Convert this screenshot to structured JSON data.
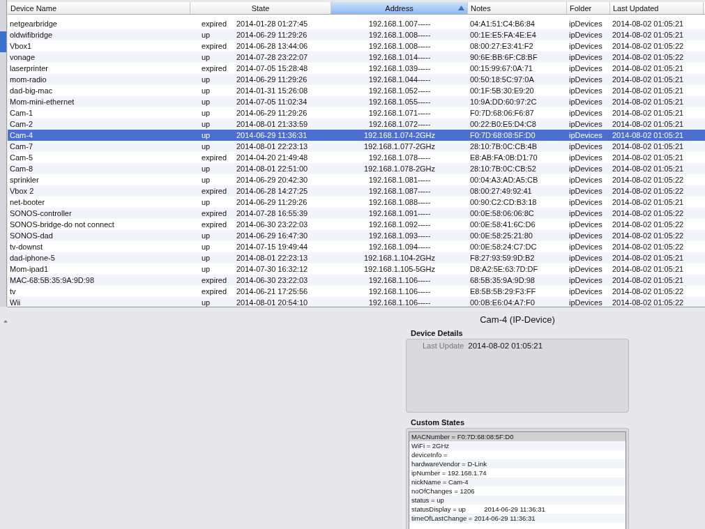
{
  "table": {
    "columns": [
      {
        "label": "Device Name",
        "sorted": false
      },
      {
        "label": "State",
        "sorted": false
      },
      {
        "label": "Address",
        "sorted": true
      },
      {
        "label": "Notes",
        "sorted": false
      },
      {
        "label": "Folder",
        "sorted": false
      },
      {
        "label": "Last Updated",
        "sorted": false
      }
    ],
    "rows": [
      {
        "name": "netgearbridge",
        "state": "expired",
        "changed": "2014-01-28 01:27:45",
        "address": "192.168.1.007-----",
        "notes": "04:A1:51:C4:B6:84",
        "folder": "ipDevices",
        "updated": "2014-08-02 01:05:21",
        "selected": false
      },
      {
        "name": "oldwifibridge",
        "state": "up",
        "changed": "2014-06-29 11:29:26",
        "address": "192.168.1.008-----",
        "notes": "00:1E:E5:FA:4E:E4",
        "folder": "ipDevices",
        "updated": "2014-08-02 01:05:21",
        "selected": false
      },
      {
        "name": "Vbox1",
        "state": "expired",
        "changed": "2014-06-28 13:44:06",
        "address": "192.168.1.008-----",
        "notes": "08:00:27:E3:41:F2",
        "folder": "ipDevices",
        "updated": "2014-08-02 01:05:22",
        "selected": false
      },
      {
        "name": "vonage",
        "state": "up",
        "changed": "2014-07-28 23:22:07",
        "address": "192.168.1.014-----",
        "notes": "90:6E:BB:6F:C8:BF",
        "folder": "ipDevices",
        "updated": "2014-08-02 01:05:22",
        "selected": false
      },
      {
        "name": "laserprinter",
        "state": "expired",
        "changed": "2014-07-05 15:28:48",
        "address": "192.168.1.039-----",
        "notes": "00:15:99:67:0A:71",
        "folder": "ipDevices",
        "updated": "2014-08-02 01:05:21",
        "selected": false
      },
      {
        "name": "mom-radio",
        "state": "up",
        "changed": "2014-06-29 11:29:26",
        "address": "192.168.1.044-----",
        "notes": "00:50:18:5C:97:0A",
        "folder": "ipDevices",
        "updated": "2014-08-02 01:05:21",
        "selected": false
      },
      {
        "name": "dad-big-mac",
        "state": "up",
        "changed": "2014-01-31 15:26:08",
        "address": "192.168.1.052-----",
        "notes": "00:1F:5B:30:E9:20",
        "folder": "ipDevices",
        "updated": "2014-08-02 01:05:21",
        "selected": false
      },
      {
        "name": "Mom-mini-ethernet",
        "state": "up",
        "changed": "2014-07-05 11:02:34",
        "address": "192.168.1.055-----",
        "notes": "10:9A:DD:60:97:2C",
        "folder": "ipDevices",
        "updated": "2014-08-02 01:05:21",
        "selected": false
      },
      {
        "name": "Cam-1",
        "state": "up",
        "changed": "2014-06-29 11:29:26",
        "address": "192.168.1.071-----",
        "notes": "F0:7D:68:06:F6:87",
        "folder": "ipDevices",
        "updated": "2014-08-02 01:05:21",
        "selected": false
      },
      {
        "name": "Cam-2",
        "state": "up",
        "changed": "2014-08-01 21:33:59",
        "address": "192.168.1.072-----",
        "notes": "00:22:B0:E5:D4:C8",
        "folder": "ipDevices",
        "updated": "2014-08-02 01:05:21",
        "selected": false
      },
      {
        "name": "Cam-4",
        "state": "up",
        "changed": "2014-06-29 11:36:31",
        "address": "192.168.1.074-2GHz",
        "notes": "F0:7D:68:08:5F:D0",
        "folder": "ipDevices",
        "updated": "2014-08-02 01:05:21",
        "selected": true
      },
      {
        "name": "Cam-7",
        "state": "up",
        "changed": "2014-08-01 22:23:13",
        "address": "192.168.1.077-2GHz",
        "notes": "28:10:7B:0C:CB:4B",
        "folder": "ipDevices",
        "updated": "2014-08-02 01:05:21",
        "selected": false
      },
      {
        "name": "Cam-5",
        "state": "expired",
        "changed": "2014-04-20 21:49:48",
        "address": "192.168.1.078-----",
        "notes": "E8:AB:FA:0B:D1:70",
        "folder": "ipDevices",
        "updated": "2014-08-02 01:05:21",
        "selected": false
      },
      {
        "name": "Cam-8",
        "state": "up",
        "changed": "2014-08-01 22:51:00",
        "address": "192.168.1.078-2GHz",
        "notes": "28:10:7B:0C:CB:52",
        "folder": "ipDevices",
        "updated": "2014-08-02 01:05:21",
        "selected": false
      },
      {
        "name": "sprinkler",
        "state": "up",
        "changed": "2014-06-29 20:42:30",
        "address": "192.168.1.081-----",
        "notes": "00:04:A3:AD:A5:CB",
        "folder": "ipDevices",
        "updated": "2014-08-02 01:05:22",
        "selected": false
      },
      {
        "name": "Vbox 2",
        "state": "expired",
        "changed": "2014-06-28 14:27:25",
        "address": "192.168.1.087-----",
        "notes": "08:00:27:49:92:41",
        "folder": "ipDevices",
        "updated": "2014-08-02 01:05:22",
        "selected": false
      },
      {
        "name": "net-booter",
        "state": "up",
        "changed": "2014-06-29 11:29:26",
        "address": "192.168.1.088-----",
        "notes": "00:90:C2:CD:B3:18",
        "folder": "ipDevices",
        "updated": "2014-08-02 01:05:21",
        "selected": false
      },
      {
        "name": "SONOS-controller",
        "state": "expired",
        "changed": "2014-07-28 16:55:39",
        "address": "192.168.1.091-----",
        "notes": "00:0E:58:06:06:8C",
        "folder": "ipDevices",
        "updated": "2014-08-02 01:05:22",
        "selected": false
      },
      {
        "name": "SONOS-bridge-do not connect",
        "state": "expired",
        "changed": "2014-06-30 23:22:03",
        "address": "192.168.1.092-----",
        "notes": "00:0E:58:41:6C:D6",
        "folder": "ipDevices",
        "updated": "2014-08-02 01:05:22",
        "selected": false
      },
      {
        "name": "SONOS-dad",
        "state": "up",
        "changed": "2014-06-29 16:47:30",
        "address": "192.168.1.093-----",
        "notes": "00:0E:58:25:21:80",
        "folder": "ipDevices",
        "updated": "2014-08-02 01:05:22",
        "selected": false
      },
      {
        "name": "tv-downst",
        "state": "up",
        "changed": "2014-07-15 19:49:44",
        "address": "192.168.1.094-----",
        "notes": "00:0E:58:24:C7:DC",
        "folder": "ipDevices",
        "updated": "2014-08-02 01:05:22",
        "selected": false
      },
      {
        "name": "dad-iphone-5",
        "state": "up",
        "changed": "2014-08-01 22:23:13",
        "address": "192.168.1.104-2GHz",
        "notes": "F8:27:93:59:9D:B2",
        "folder": "ipDevices",
        "updated": "2014-08-02 01:05:21",
        "selected": false
      },
      {
        "name": "Mom-ipad1",
        "state": "up",
        "changed": "2014-07-30 16:32:12",
        "address": "192.168.1.105-5GHz",
        "notes": "D8:A2:5E:63:7D:DF",
        "folder": "ipDevices",
        "updated": "2014-08-02 01:05:21",
        "selected": false
      },
      {
        "name": "MAC-68:5B:35:9A:9D:98",
        "state": "expired",
        "changed": "2014-06-30 23:22:03",
        "address": "192.168.1.106-----",
        "notes": "68:5B:35:9A:9D:98",
        "folder": "ipDevices",
        "updated": "2014-08-02 01:05:21",
        "selected": false
      },
      {
        "name": "tv",
        "state": "expired",
        "changed": "2014-06-21 17:25:56",
        "address": "192.168.1.106-----",
        "notes": "E8:5B:5B:29:F3:FF",
        "folder": "ipDevices",
        "updated": "2014-08-02 01:05:22",
        "selected": false
      },
      {
        "name": "Wii",
        "state": "up",
        "changed": "2014-08-01 20:54:10",
        "address": "192.168.1.106-----",
        "notes": "00:0B:E6:04:A7:F0",
        "folder": "ipDevices",
        "updated": "2014-08-02 01:05:22",
        "selected": false
      }
    ]
  },
  "detail": {
    "title": "Cam-4 (IP-Device)",
    "device_details": {
      "heading": "Device Details",
      "label": "Last Update",
      "value": "2014-08-02 01:05:21"
    },
    "custom_states": {
      "heading": "Custom States",
      "items": [
        {
          "text": "MACNumber = F0:7D:68:08:5F:D0",
          "selected": true
        },
        {
          "text": "WiFi = 2GHz",
          "selected": false
        },
        {
          "text": "deviceInfo =",
          "selected": false
        },
        {
          "text": "hardwareVendor = D-Link",
          "selected": false
        },
        {
          "text": "ipNumber = 192.168.1.74",
          "selected": false
        },
        {
          "text": "nickName = Cam-4",
          "selected": false
        },
        {
          "text": "noOfChanges = 1206",
          "selected": false
        },
        {
          "text": "status = up",
          "selected": false
        },
        {
          "text": "statusDisplay = up          2014-06-29 11:36:31",
          "selected": false
        },
        {
          "text": "timeOfLastChange = 2014-06-29 11:36:31",
          "selected": false
        }
      ]
    }
  }
}
